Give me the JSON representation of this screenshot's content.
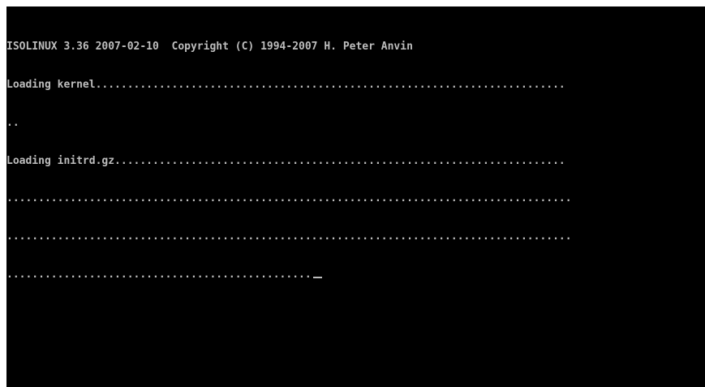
{
  "console": {
    "lines": [
      "ISOLINUX 3.36 2007-02-10  Copyright (C) 1994-2007 H. Peter Anvin",
      "Loading kernel..........................................................................",
      "..",
      "Loading initrd.gz.......................................................................",
      ".........................................................................................",
      ".........................................................................................",
      "................................................"
    ],
    "foreground_color": "#bdbdbd",
    "background_color": "#000000"
  }
}
